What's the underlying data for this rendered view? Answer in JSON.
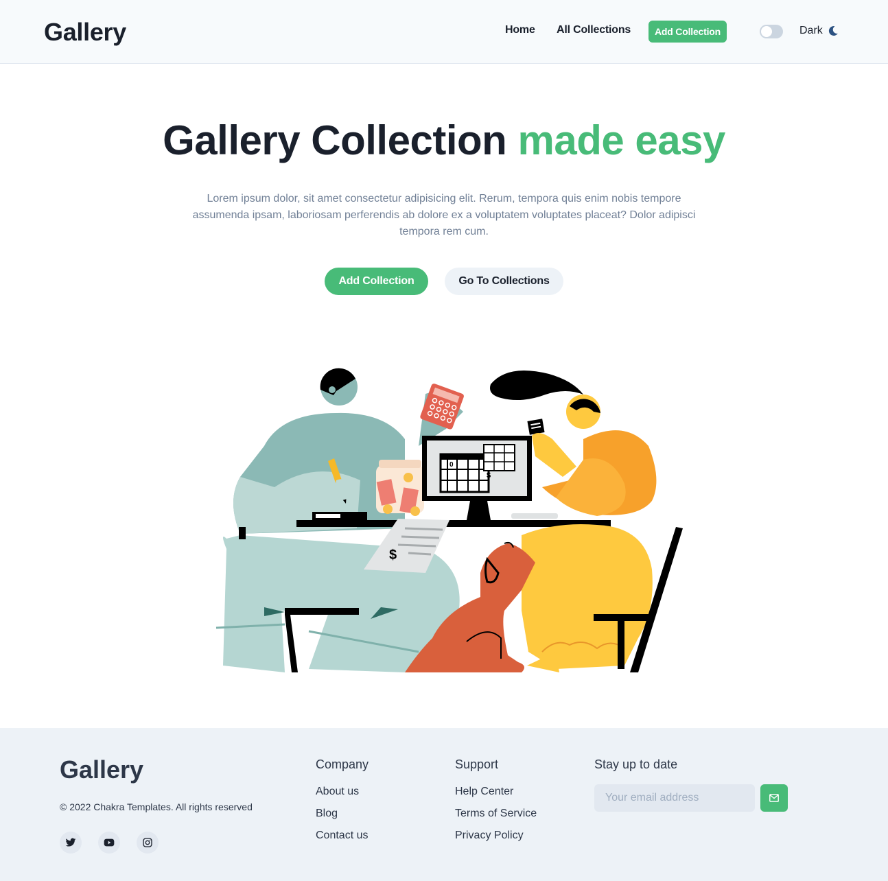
{
  "header": {
    "brand": "Gallery",
    "nav": {
      "home": "Home",
      "all_collections": "All Collections",
      "add_collection": "Add Collection"
    },
    "theme_toggle": {
      "label": "Dark",
      "checked": false,
      "icon": "moon-icon"
    }
  },
  "hero": {
    "title": "Gallery Collection",
    "title_accent": "made easy",
    "description": "Lorem ipsum dolor, sit amet consectetur adipisicing elit. Rerum, tempora quis enim nobis tempore assumenda ipsam, laboriosam perferendis ab dolore ex a voluptatem voluptates placeat? Dolor adipisci tempora rem cum.",
    "primary_button": "Add Collection",
    "secondary_button": "Go To Collections"
  },
  "footer": {
    "brand": "Gallery",
    "copyright": "© 2022 Chakra Templates. All rights reserved",
    "social": [
      "twitter-icon",
      "youtube-icon",
      "instagram-icon"
    ],
    "company": {
      "heading": "Company",
      "links": [
        "About us",
        "Blog",
        "Contact us"
      ]
    },
    "support": {
      "heading": "Support",
      "links": [
        "Help Center",
        "Terms of Service",
        "Privacy Policy"
      ]
    },
    "newsletter": {
      "heading": "Stay up to date",
      "placeholder": "Your email address",
      "icon": "send-mail-icon"
    }
  },
  "colors": {
    "accent": "#48bb78",
    "text": "#1a202c",
    "muted": "#718096",
    "footer_bg": "#edf2f7"
  }
}
